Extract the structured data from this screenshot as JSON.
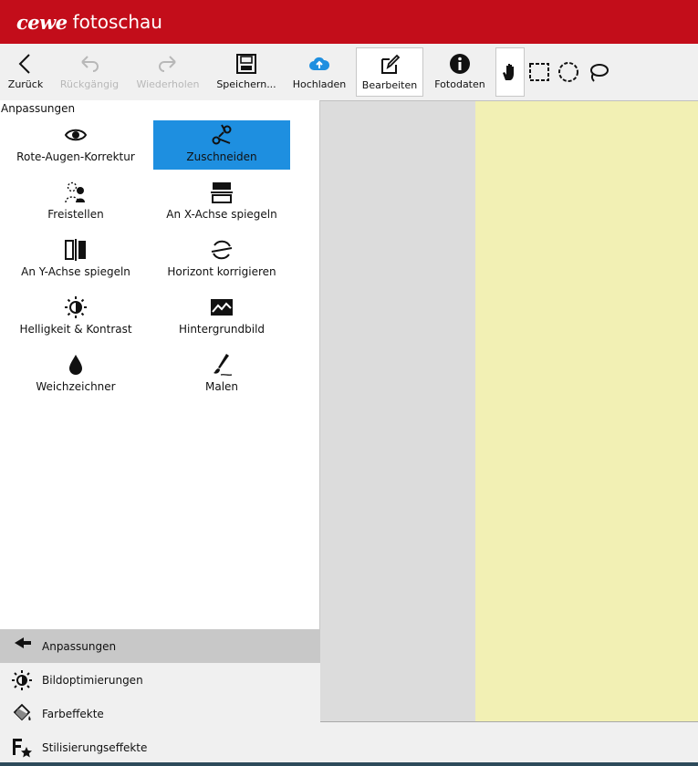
{
  "app": {
    "logo_text": "cewe",
    "name": "fotoschau"
  },
  "toolbar": {
    "back": "Zurück",
    "undo": "Rückgängig",
    "redo": "Wiederholen",
    "save": "Speichern...",
    "upload": "Hochladen",
    "edit": "Bearbeiten",
    "photo_data": "Fotodaten",
    "accent_color": "#1e8fe0"
  },
  "panel": {
    "heading": "Anpassungen",
    "tools": [
      {
        "label": "Rote-Augen-Korrektur",
        "icon": "eye-icon"
      },
      {
        "label": "Zuschneiden",
        "icon": "scissors-icon",
        "selected": true
      },
      {
        "label": "Freistellen",
        "icon": "cutout-person-icon"
      },
      {
        "label": "An X-Achse spiegeln",
        "icon": "flip-horizontal-axis-icon"
      },
      {
        "label": "An Y-Achse spiegeln",
        "icon": "flip-vertical-axis-icon"
      },
      {
        "label": "Horizont korrigieren",
        "icon": "horizon-icon"
      },
      {
        "label": "Helligkeit & Kontrast",
        "icon": "brightness-icon"
      },
      {
        "label": "Hintergrundbild",
        "icon": "background-image-icon"
      },
      {
        "label": "Weichzeichner",
        "icon": "drop-icon"
      },
      {
        "label": "Malen",
        "icon": "brush-icon"
      }
    ]
  },
  "nav": [
    {
      "label": "Anpassungen",
      "icon": "arrow-left-icon",
      "active": true
    },
    {
      "label": "Bildoptimierungen",
      "icon": "sun-icon"
    },
    {
      "label": "Farbeffekte",
      "icon": "paint-bucket-icon"
    },
    {
      "label": "Stilisierungseffekte",
      "icon": "f-star-icon"
    }
  ],
  "colors": {
    "titlebar": "#c30d1a",
    "photo": "#f2f0b4"
  }
}
